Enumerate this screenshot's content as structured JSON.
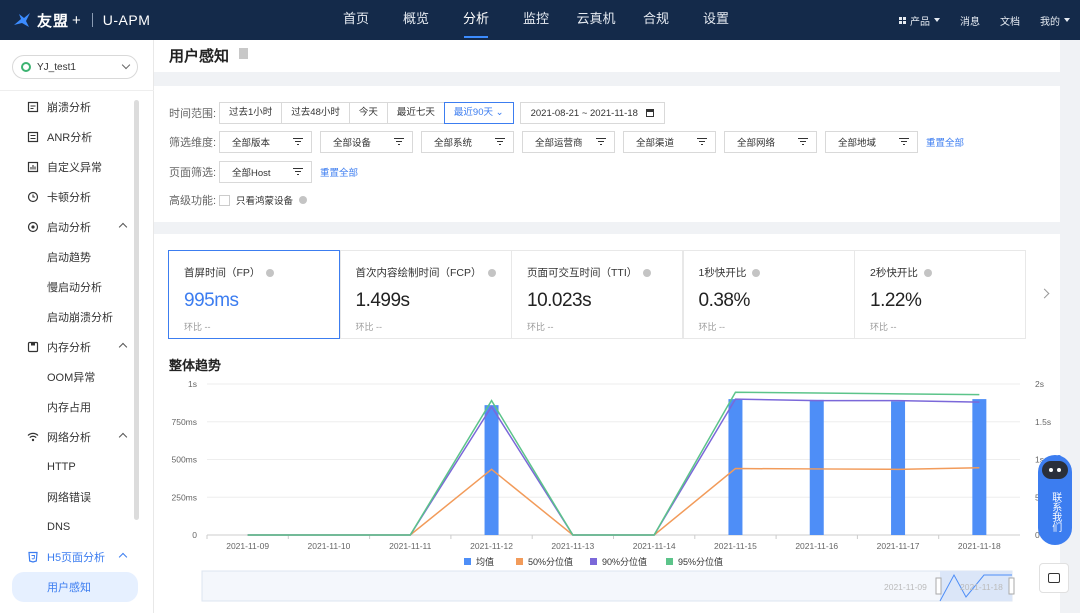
{
  "brand": {
    "name": "友盟",
    "plus": "+",
    "product": "U-APM"
  },
  "nav": {
    "items": [
      {
        "label": "首页",
        "active": false
      },
      {
        "label": "概览",
        "active": false
      },
      {
        "label": "分析",
        "active": true
      },
      {
        "label": "监控",
        "active": false
      },
      {
        "label": "云真机",
        "active": false
      },
      {
        "label": "合规",
        "active": false
      },
      {
        "label": "设置",
        "active": false
      }
    ],
    "right": {
      "products": "产品",
      "messages": "消息",
      "docs": "文档",
      "mine": "我的"
    }
  },
  "sidebar": {
    "app_name": "YJ_test1",
    "items": [
      {
        "label": "崩溃分析",
        "icon": "crash-icon",
        "type": "top"
      },
      {
        "label": "ANR分析",
        "icon": "anr-icon",
        "type": "top"
      },
      {
        "label": "自定义异常",
        "icon": "custom-exception-icon",
        "type": "top"
      },
      {
        "label": "卡顿分析",
        "icon": "lag-icon",
        "type": "top"
      },
      {
        "label": "启动分析",
        "icon": "startup-icon",
        "type": "group"
      },
      {
        "label": "启动趋势",
        "type": "sub"
      },
      {
        "label": "慢启动分析",
        "type": "sub"
      },
      {
        "label": "启动崩溃分析",
        "type": "sub"
      },
      {
        "label": "内存分析",
        "icon": "memory-icon",
        "type": "group"
      },
      {
        "label": "OOM异常",
        "type": "sub"
      },
      {
        "label": "内存占用",
        "type": "sub"
      },
      {
        "label": "网络分析",
        "icon": "wifi-icon",
        "type": "group"
      },
      {
        "label": "HTTP",
        "type": "sub"
      },
      {
        "label": "网络错误",
        "type": "sub"
      },
      {
        "label": "DNS",
        "type": "sub"
      },
      {
        "label": "H5页面分析",
        "icon": "h5-icon",
        "type": "group-active"
      },
      {
        "label": "用户感知",
        "type": "sub-selected"
      }
    ]
  },
  "page": {
    "title": "用户感知"
  },
  "filters": {
    "time_label": "时间范围:",
    "time_options": [
      "过去1小时",
      "过去48小时",
      "今天",
      "最近七天",
      "最近90天"
    ],
    "time_active": "最近90天",
    "date_range": "2021-08-21 ~ 2021-11-18",
    "dim_label": "筛选维度:",
    "dimensions": [
      "全部版本",
      "全部设备",
      "全部系统",
      "全部运营商",
      "全部渠道",
      "全部网络",
      "全部地域"
    ],
    "reset_all": "重置全部",
    "page_label": "页面筛选:",
    "host": "全部Host",
    "reset_page": "重置全部",
    "advanced_label": "高级功能:",
    "harmony_only": "只看鸿蒙设备"
  },
  "metrics": [
    {
      "label": "首屏时间（FP）",
      "value": "995ms",
      "cmp": "环比  --",
      "active": true
    },
    {
      "label": "首次内容绘制时间（FCP）",
      "value": "1.499s",
      "cmp": "环比  --",
      "active": false
    },
    {
      "label": "页面可交互时间（TTI）",
      "value": "10.023s",
      "cmp": "环比  --",
      "active": false
    },
    {
      "label": "1秒快开比",
      "value": "0.38%",
      "cmp": "环比  --",
      "active": false
    },
    {
      "label": "2秒快开比",
      "value": "1.22%",
      "cmp": "环比  --",
      "active": false
    }
  ],
  "section_title": "整体趋势",
  "chart_data": {
    "type": "bar",
    "title": "整体趋势",
    "categories": [
      "2021-11-09",
      "2021-11-10",
      "2021-11-11",
      "2021-11-12",
      "2021-11-13",
      "2021-11-14",
      "2021-11-15",
      "2021-11-16",
      "2021-11-17",
      "2021-11-18"
    ],
    "left_axis_ticks": [
      "0",
      "250ms",
      "500ms",
      "750ms",
      "1s"
    ],
    "right_axis_ticks": [
      "0",
      "500m",
      "1s",
      "1.5s",
      "2s"
    ],
    "ylim_left_ms": [
      0,
      1000
    ],
    "ylim_right_ms": [
      0,
      2000
    ],
    "series": [
      {
        "name": "均值",
        "type": "bar",
        "axis": "left",
        "color": "#4e8ef7",
        "values_ms": [
          0,
          0,
          0,
          860,
          0,
          0,
          900,
          895,
          885,
          900
        ]
      },
      {
        "name": "50%分位值",
        "type": "line",
        "axis": "right",
        "color": "#f29b5a",
        "values_ms": [
          0,
          0,
          0,
          870,
          0,
          0,
          880,
          875,
          870,
          890
        ]
      },
      {
        "name": "90%分位值",
        "type": "line",
        "axis": "right",
        "color": "#7b68d9",
        "values_ms": [
          0,
          0,
          0,
          1700,
          0,
          0,
          1800,
          1780,
          1780,
          1760
        ]
      },
      {
        "name": "95%分位值",
        "type": "line",
        "axis": "right",
        "color": "#5cc48a",
        "values_ms": [
          0,
          0,
          0,
          1780,
          0,
          0,
          1890,
          1880,
          1870,
          1860
        ]
      }
    ],
    "legend_position": "bottom",
    "grid": "horizontal",
    "slider": {
      "start_label": "2021-11-09",
      "end_label": "2021-11-18"
    }
  },
  "float": {
    "contact": "联系我们"
  }
}
